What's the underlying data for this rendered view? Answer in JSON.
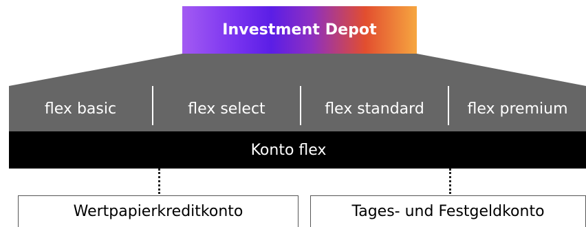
{
  "header": {
    "title": "Investment Depot",
    "gradient_colors": [
      "#a35bf2",
      "#5b1ee6",
      "#e24e2f",
      "#f6a640"
    ]
  },
  "tiers": {
    "items": [
      {
        "label": "flex basic"
      },
      {
        "label": "flex select"
      },
      {
        "label": "flex standard"
      },
      {
        "label": "flex premium"
      }
    ],
    "band_color": "#666666"
  },
  "base": {
    "label": "Konto flex",
    "color": "#000000"
  },
  "accounts": {
    "items": [
      {
        "label": "Wertpapierkreditkonto"
      },
      {
        "label": "Tages- und Festgeldkonto"
      }
    ]
  }
}
